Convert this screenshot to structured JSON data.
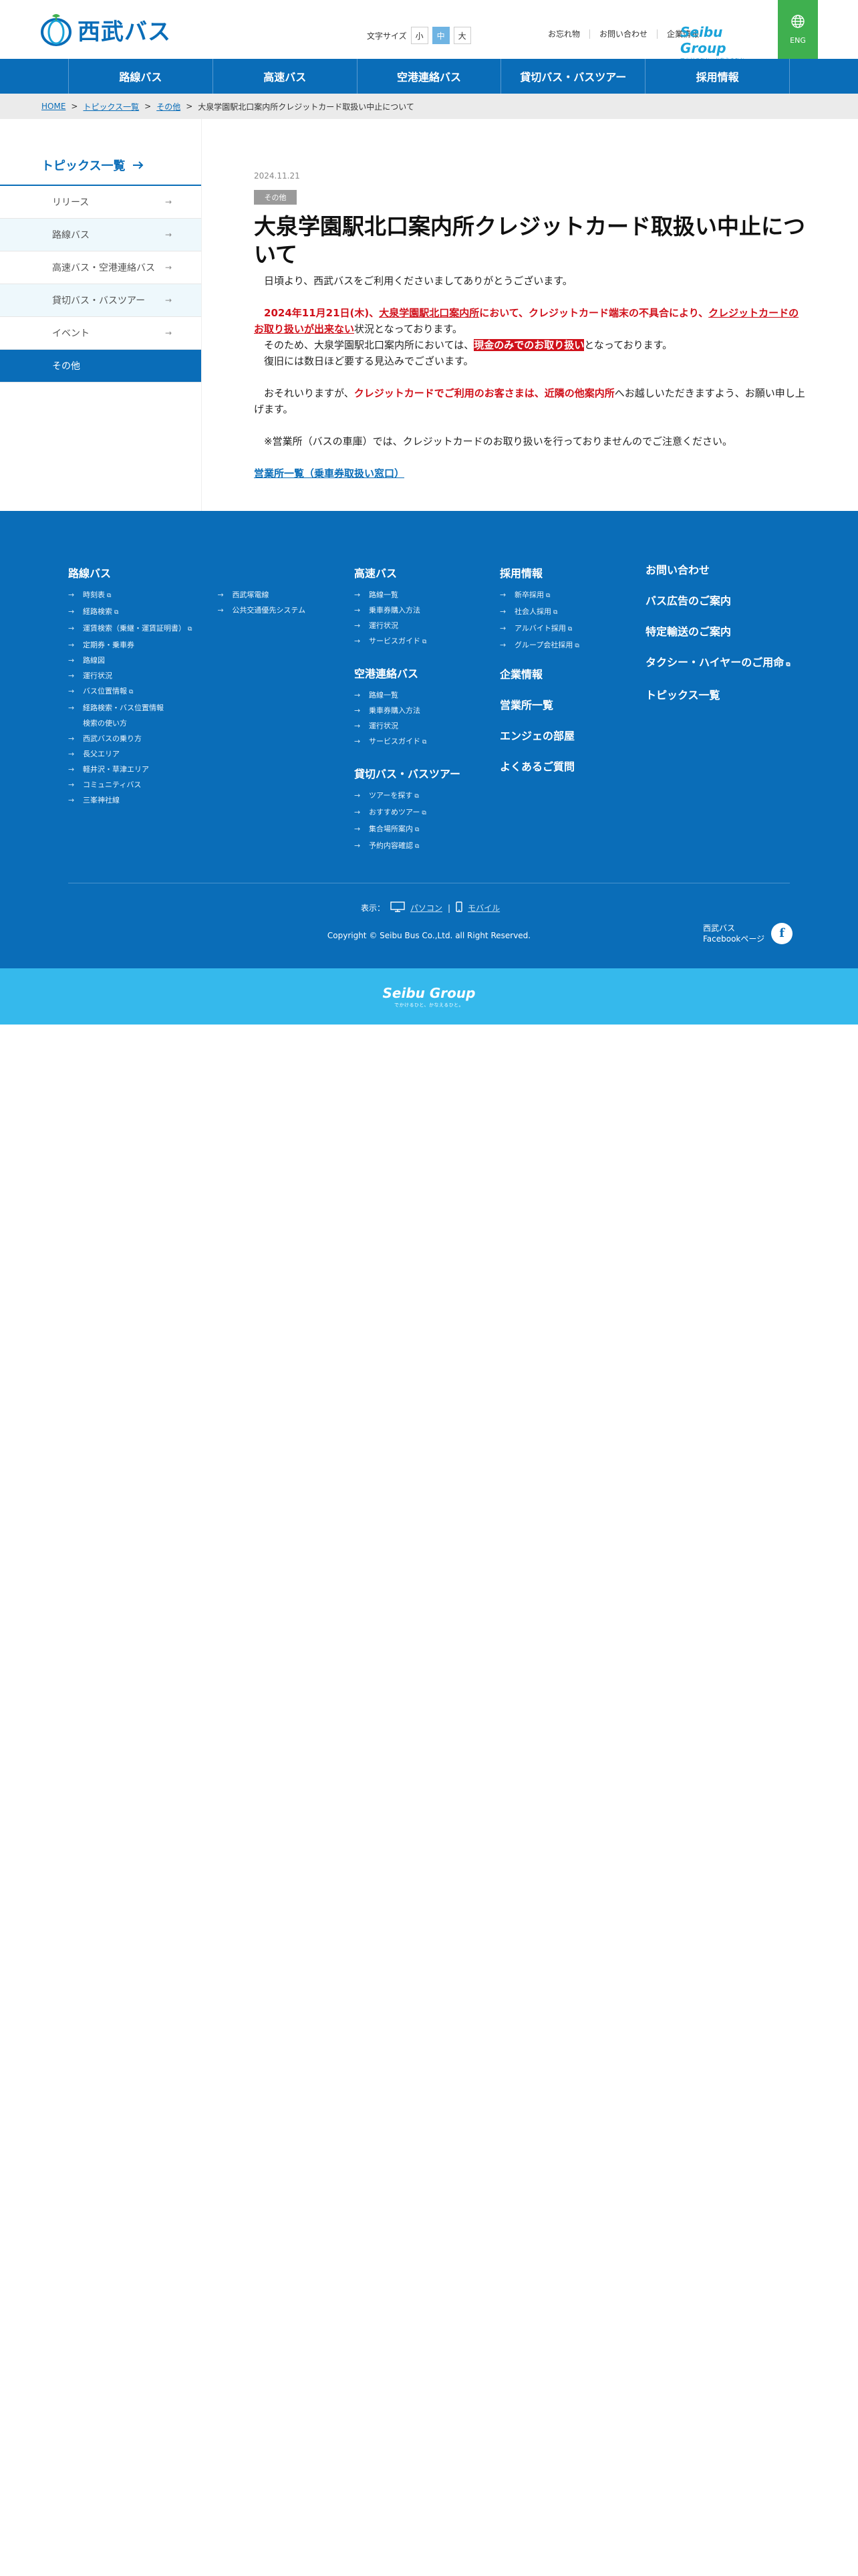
{
  "header": {
    "logo_text": "西武バス",
    "font_size_label": "文字サイズ",
    "font_sizes": [
      "小",
      "中",
      "大"
    ],
    "font_size_selected": "中",
    "util_links": [
      "お忘れ物",
      "お問い合わせ",
      "企業情報"
    ],
    "group_name": "Seibu Group",
    "group_tagline": "でかけるひと、かなえるひと。",
    "eng_label": "ENG"
  },
  "gnav": [
    "路線バス",
    "高速バス",
    "空港連絡バス",
    "貸切バス・バスツアー",
    "採用情報"
  ],
  "breadcrumb": {
    "home": "HOME",
    "topics": "トピックス一覧",
    "category": "その他",
    "current": "大泉学園駅北口案内所クレジットカード取扱い中止について",
    "sep": ">"
  },
  "side": {
    "title": "トピックス一覧",
    "items": [
      "リリース",
      "路線バス",
      "高速バス・空港連絡バス",
      "貸切バス・バスツアー",
      "イベント",
      "その他"
    ],
    "active": "その他"
  },
  "article": {
    "date": "2024.11.21",
    "category": "その他",
    "title": "大泉学園駅北口案内所クレジットカード取扱い中止について",
    "p1": "日頃より、西武バスをご利用くださいましてありがとうございます。",
    "p2_a": "2024年11月21日(木)、",
    "p2_b": "大泉学園駅北口案内所",
    "p2_c": "において、クレジットカード端末の不具合により、",
    "p2_d": "クレジットカードのお取り扱いが出来ない",
    "p2_e": "状況となっております。",
    "p3_a": "そのため、大泉学園駅北口案内所においては、",
    "p3_b": "現金のみでのお取り扱い",
    "p3_c": "となっております。",
    "p4": "復旧には数日ほど要する見込みでございます。",
    "p5_a": "おそれいりますが、",
    "p5_b": "クレジットカードでご利用のお客さまは、近隣の他案内所",
    "p5_c": "へお越しいただきますよう、お願い申し上げます。",
    "p6": "※営業所（バスの車庫）では、クレジットカードのお取り扱いを行っておりませんのでご注意ください。",
    "link": "営業所一覧（乗車券取扱い窓口）"
  },
  "footer": {
    "col1": {
      "head": "路線バス",
      "items_a": [
        "時刻表",
        "経路検索",
        "運賃検索（乗継・運賃証明書）",
        "定期券・乗車券",
        "路線図",
        "運行状況",
        "バス位置情報",
        "経路検索・バス位置情報\n検索の使い方",
        "西武バスの乗り方",
        "長父エリア",
        "軽井沢・草津エリア",
        "コミュニティバス",
        "三峯神社線"
      ],
      "items_b": [
        "西武塚電線",
        "公共交通優先システム"
      ]
    },
    "col2": {
      "head": "高速バス",
      "items": [
        "路線一覧",
        "乗車券購入方法",
        "運行状況",
        "サービスガイド"
      ],
      "head2": "空港連絡バス",
      "items2": [
        "路線一覧",
        "乗車券購入方法",
        "運行状況",
        "サービスガイド"
      ],
      "head3": "貸切バス・バスツアー",
      "items3": [
        "ツアーを探す",
        "おすすめツアー",
        "集合場所案内",
        "予約内容確認"
      ]
    },
    "col3": {
      "head": "採用情報",
      "items": [
        "新卒採用",
        "社会人採用",
        "アルバイト採用",
        "グループ会社採用"
      ],
      "big": [
        "企業情報",
        "営業所一覧",
        "エンジェの部屋",
        "よくあるご質問"
      ]
    },
    "col4": {
      "big": [
        "お問い合わせ",
        "バス広告のご案内",
        "特定輸送のご案内",
        "タクシー・ハイヤーのご用命",
        "トピックス一覧"
      ]
    },
    "display_label": "表示：",
    "display_pc": "パソコン",
    "display_mobile": "モバイル",
    "copyright": "Copyright © Seibu Bus Co.,Ltd. all Right Reserved.",
    "fb_line1": "西武バス",
    "fb_line2": "Facebookページ",
    "fb_icon": "f"
  },
  "band": {
    "group_name": "Seibu Group",
    "group_tagline": "でかけるひと、かなえるひと。"
  },
  "colors": {
    "brand_blue": "#0a6db8",
    "sky_blue": "#35b9ec",
    "green": "#3fb04f",
    "red": "#d0111b"
  }
}
